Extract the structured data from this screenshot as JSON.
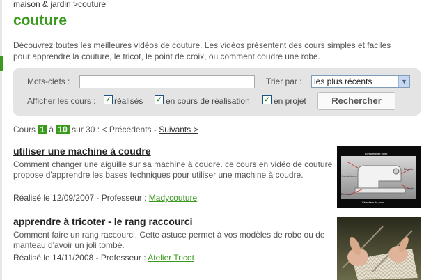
{
  "breadcrumb": {
    "parent": "maison & jardin",
    "separator": " >",
    "current": "couture"
  },
  "page_title": "couture",
  "intro": "Découvrez toutes les meilleures vidéos de couture. Les vidéos présentent des cours simples et faciles pour apprendre la couture, le tricot, le point de croix, ou comment coudre une robe.",
  "search": {
    "keywords_label": "Mots-clefs :",
    "keywords_value": "",
    "sort_label": "Trier par :",
    "sort_selected": "les plus récents",
    "show_label": "Afficher les cours :",
    "filters": [
      {
        "label": "réalisés",
        "checked": true
      },
      {
        "label": "en cours de réalisation",
        "checked": true
      },
      {
        "label": "en projet",
        "checked": true
      }
    ],
    "submit_label": "Rechercher"
  },
  "pager": {
    "prefix": "Cours",
    "from": "1",
    "to_word": "à",
    "to": "10",
    "total_text": "sur 30 :",
    "prev": "< Précédents -",
    "next": "Suivants >"
  },
  "results": [
    {
      "title": "utiliser une machine à coudre",
      "description": "Comment changer une aiguille sur sa machine à coudre. ce cours en vidéo de couture propose d'apprendre les bases techniques pour utiliser une machine à coudre.",
      "meta_prefix": "Réalisé le 12/09/2007 - Professeur :",
      "author": "Madycouture",
      "thumb_labels": [
        "Longueur de point",
        "Pied-de-biche",
        "Navette",
        "Canette",
        "Bobineur",
        "Sélecteur de point"
      ]
    },
    {
      "title": "apprendre à tricoter - le rang raccourci",
      "description": "Comment faire un rang raccourci. Cette astuce permet à vos modèles de robe ou de manteau d'avoir un joli tombé.",
      "meta_prefix": "Réalisé le 14/11/2008 - Professeur :",
      "author": "Atelier Tricot"
    }
  ],
  "colors": {
    "brand_green": "#3a9a1e",
    "panel_grey": "#e4e4e4"
  }
}
